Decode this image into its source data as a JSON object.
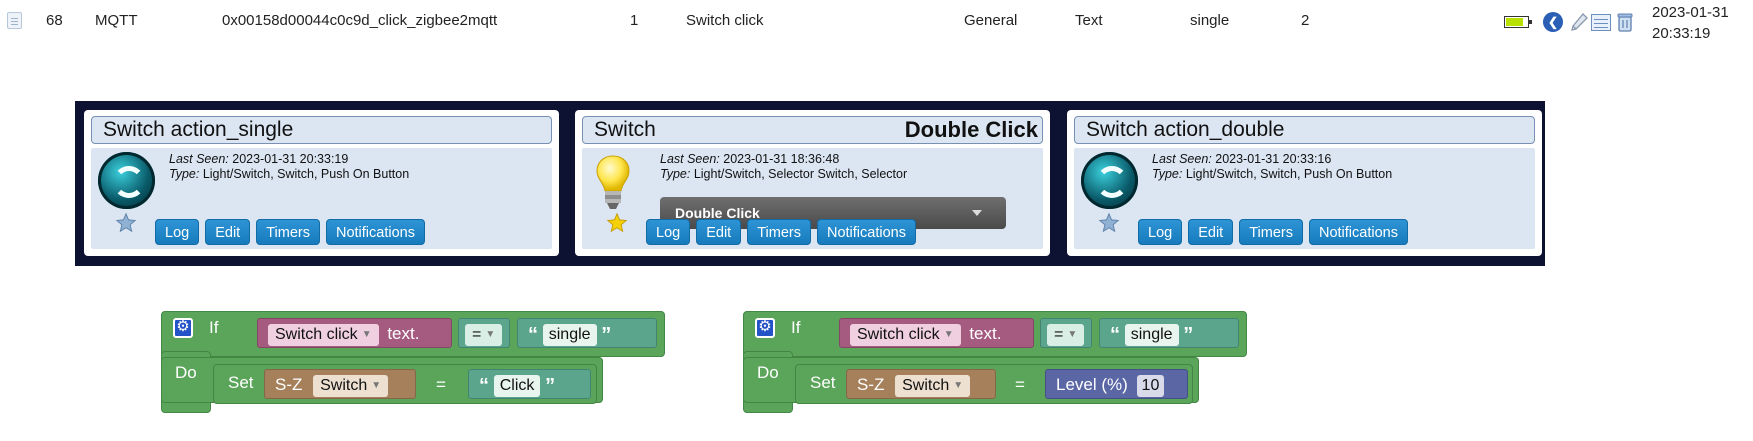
{
  "row": {
    "idx": "68",
    "hardware": "MQTT",
    "device_id": "0x00158d00044c0c9d_click_zigbee2mqtt",
    "unit": "1",
    "name": "Switch click",
    "type": "General",
    "subtype": "Text",
    "data": "single",
    "signal": "2",
    "battery_level": 0.8,
    "date": "2023-01-31",
    "time": "20:33:19",
    "icons": [
      "back-arrow-icon",
      "pencil-icon",
      "table-icon",
      "trash-icon",
      "battery-icon",
      "doc-icon"
    ]
  },
  "cards": [
    {
      "title": "Switch action_single",
      "status": "",
      "last_seen_label": "Last Seen:",
      "last_seen": "2023-01-31 20:33:19",
      "type_label": "Type:",
      "type": "Light/Switch, Switch, Push On Button",
      "icon": "switch-icon",
      "buttons": [
        "Log",
        "Edit",
        "Timers",
        "Notifications"
      ]
    },
    {
      "title": "Switch",
      "status": "Double Click",
      "last_seen_label": "Last Seen:",
      "last_seen": "2023-01-31 18:36:48",
      "type_label": "Type:",
      "type": "Light/Switch, Selector Switch, Selector",
      "icon": "bulb-icon",
      "selector_value": "Double Click",
      "buttons": [
        "Log",
        "Edit",
        "Timers",
        "Notifications"
      ]
    },
    {
      "title": "Switch action_double",
      "status": "",
      "last_seen_label": "Last Seen:",
      "last_seen": "2023-01-31 20:33:16",
      "type_label": "Type:",
      "type": "Light/Switch, Switch, Push On Button",
      "icon": "switch-icon",
      "buttons": [
        "Log",
        "Edit",
        "Timers",
        "Notifications"
      ]
    }
  ],
  "blocks": [
    {
      "if_label": "If",
      "do_label": "Do",
      "device": "Switch click",
      "property": "text.",
      "operator": "=",
      "compare_value": "single",
      "set_label": "Set",
      "target_group": "S-Z",
      "target_device": "Switch",
      "assign": "=",
      "value_type": "string",
      "value": "Click"
    },
    {
      "if_label": "If",
      "do_label": "Do",
      "device": "Switch click",
      "property": "text.",
      "operator": "=",
      "compare_value": "single",
      "set_label": "Set",
      "target_group": "S-Z",
      "target_device": "Switch",
      "assign": "=",
      "value_type": "level",
      "value_label": "Level (%)",
      "value": "10"
    }
  ],
  "colors": {
    "panel_bg": "#0d1233",
    "button": "#2287c9",
    "if_block": "#5ba55b",
    "device_block": "#a55b80",
    "string_block": "#5ba58c",
    "set_block": "#a5805b",
    "level_block": "#5b67a5"
  }
}
